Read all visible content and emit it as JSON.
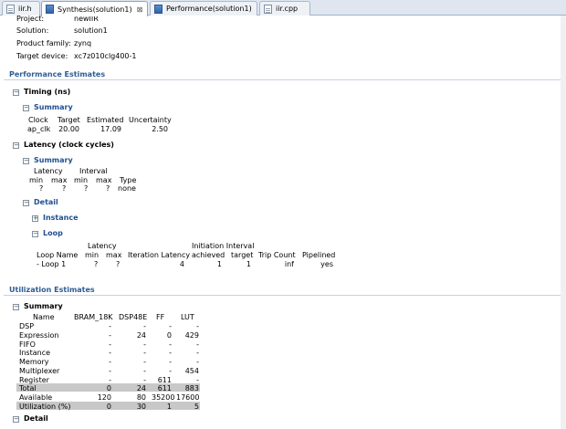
{
  "tabs": [
    {
      "label": "iir.h"
    },
    {
      "label": "Synthesis(solution1)"
    },
    {
      "label": "Performance(solution1)"
    },
    {
      "label": "iir.cpp"
    }
  ],
  "general": {
    "project_label": "Project:",
    "project_value": "newIIR",
    "solution_label": "Solution:",
    "solution_value": "solution1",
    "family_label": "Product family:",
    "family_value": "zynq",
    "device_label": "Target device:",
    "device_value": "xc7z010clg400-1"
  },
  "performance": {
    "title": "Performance Estimates",
    "timing": {
      "title": "Timing (ns)",
      "summary_title": "Summary",
      "headers": [
        "Clock",
        "Target",
        "Estimated",
        "Uncertainty"
      ],
      "row": [
        "ap_clk",
        "20.00",
        "17.09",
        "2.50"
      ]
    },
    "latency": {
      "title": "Latency (clock cycles)",
      "summary_title": "Summary",
      "group_latency": "Latency",
      "group_interval": "Interval",
      "headers": [
        "min",
        "max",
        "min",
        "max",
        "Type"
      ],
      "row": [
        "?",
        "?",
        "?",
        "?",
        "none"
      ],
      "detail_title": "Detail",
      "instance_title": "Instance",
      "loop_title": "Loop",
      "loop_group_latency": "Latency",
      "loop_group_ii": "Initiation Interval",
      "loop_headers": [
        "Loop Name",
        "min",
        "max",
        "Iteration Latency",
        "achieved",
        "target",
        "Trip Count",
        "Pipelined"
      ],
      "loop_row": [
        "- Loop 1",
        "?",
        "?",
        "4",
        "1",
        "1",
        "inf",
        "yes"
      ]
    }
  },
  "utilization": {
    "title": "Utilization Estimates",
    "summary_title": "Summary",
    "headers": [
      "Name",
      "BRAM_18K",
      "DSP48E",
      "FF",
      "LUT"
    ],
    "rows": [
      [
        "DSP",
        "-",
        "-",
        "-",
        "-"
      ],
      [
        "Expression",
        "-",
        "24",
        "0",
        "429"
      ],
      [
        "FIFO",
        "-",
        "-",
        "-",
        "-"
      ],
      [
        "Instance",
        "-",
        "-",
        "-",
        "-"
      ],
      [
        "Memory",
        "-",
        "-",
        "-",
        "-"
      ],
      [
        "Multiplexer",
        "-",
        "-",
        "-",
        "454"
      ],
      [
        "Register",
        "-",
        "-",
        "611",
        "-"
      ],
      [
        "Total",
        "0",
        "24",
        "611",
        "883"
      ],
      [
        "Available",
        "120",
        "80",
        "35200",
        "17600"
      ],
      [
        "Utilization (%)",
        "0",
        "30",
        "1",
        "5"
      ]
    ],
    "detail_title": "Detail"
  }
}
